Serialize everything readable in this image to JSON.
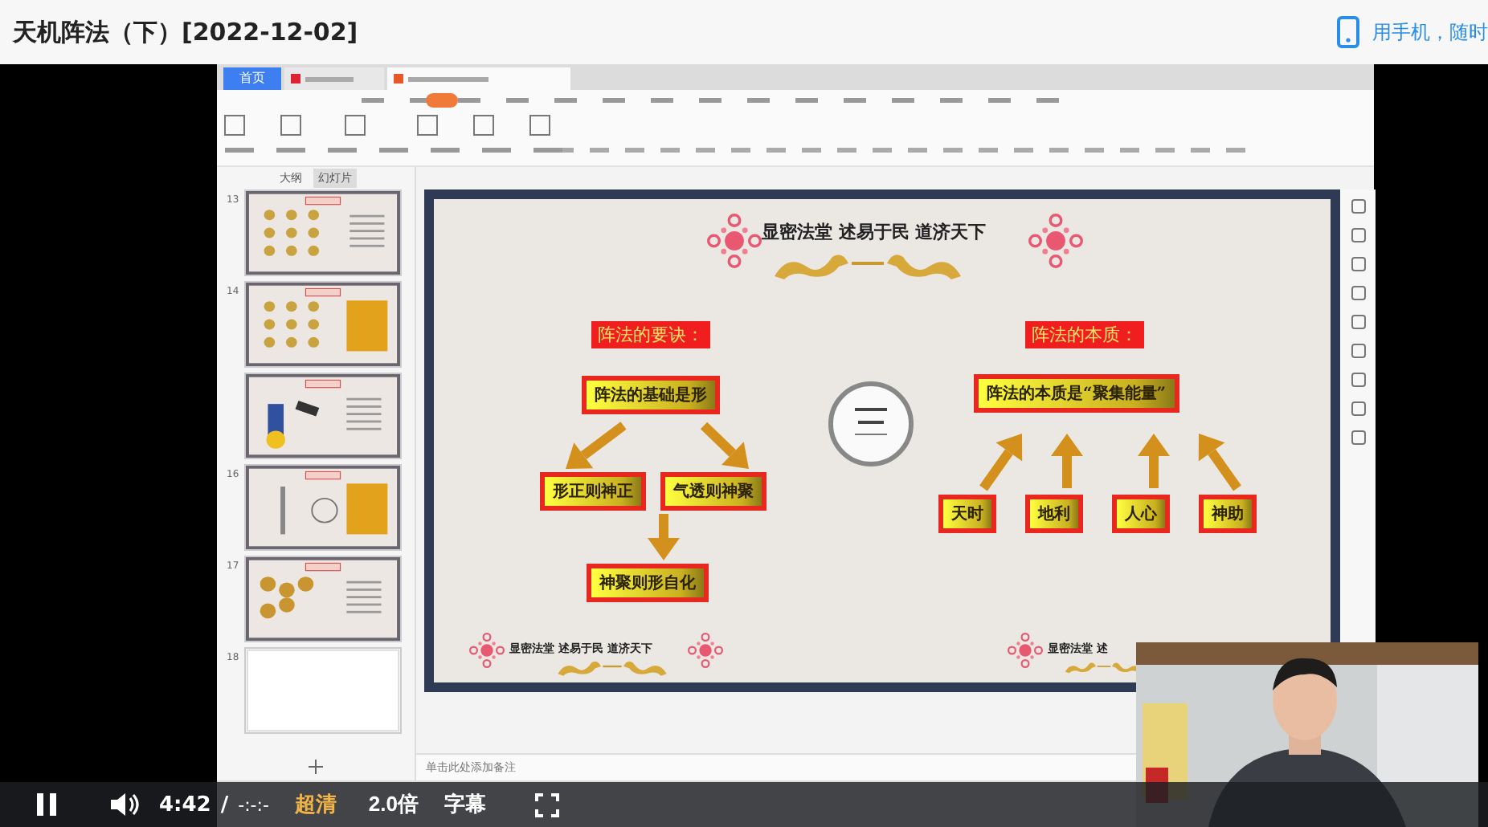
{
  "header": {
    "title": "天机阵法（下）[2022-12-02]",
    "mobile_link": "用手机，随时"
  },
  "recording": {
    "app_tabs": [
      {
        "label": "首页",
        "selected": false
      }
    ],
    "pane_tabs": [
      {
        "label": "大纲",
        "selected": false
      },
      {
        "label": "幻灯片",
        "selected": true
      }
    ],
    "thumbnails": [
      {
        "number": "13",
        "kind": "grid"
      },
      {
        "number": "14",
        "kind": "panel"
      },
      {
        "kind": "figure"
      },
      {
        "number": "16",
        "kind": "column"
      },
      {
        "number": "17",
        "kind": "cluster"
      },
      {
        "number": "18",
        "kind": "blank"
      }
    ],
    "slide": {
      "motto": "显密法堂 述易于民 道济天下",
      "left_heading": "阵法的要诀：",
      "left_root": "阵法的基础是形",
      "left_branches": [
        "形正则神正",
        "气透则神聚"
      ],
      "left_result": "神聚则形自化",
      "right_heading": "阵法的本质：",
      "right_root": "阵法的本质是“聚集能量”",
      "right_leaves": [
        "天时",
        "地利",
        "人心",
        "神助"
      ],
      "footer_mottos": [
        "显密法堂 述易于民 道济天下",
        "显密法堂 述"
      ]
    },
    "notes_placeholder": "单击此处添加备注"
  },
  "player": {
    "playing": true,
    "time": "4:42",
    "separator": "/",
    "duration": "-:-:-",
    "quality": "超清",
    "speed": "2.0倍",
    "subtitles": "字幕"
  }
}
